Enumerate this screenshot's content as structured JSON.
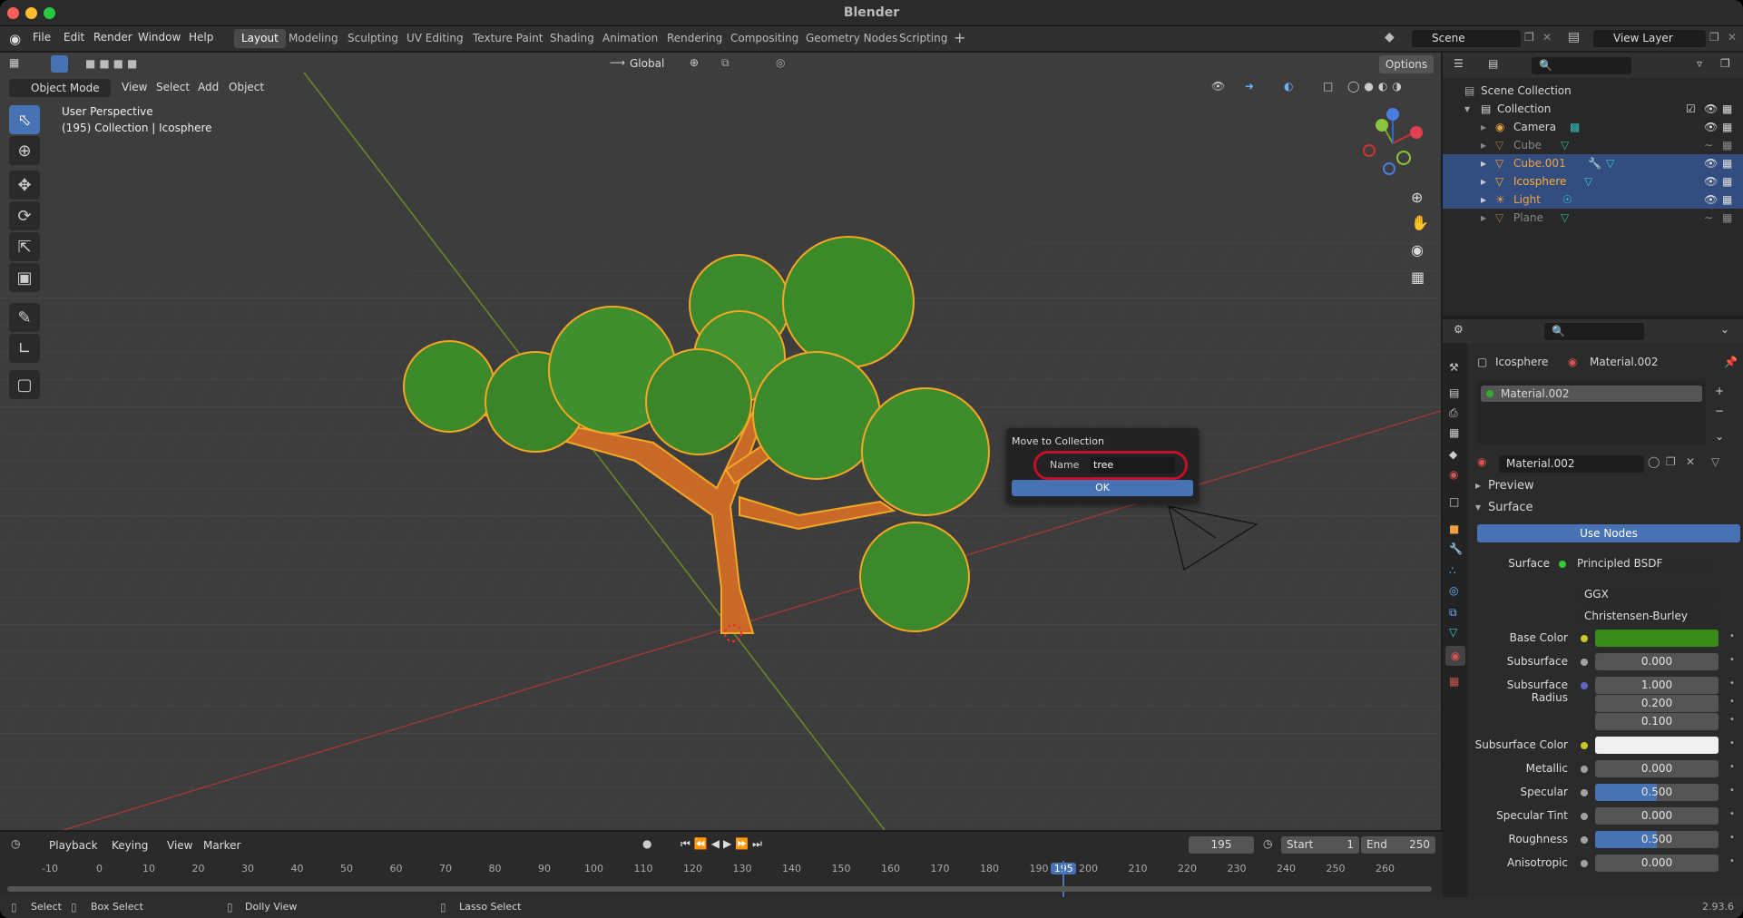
{
  "window": {
    "title": "Blender",
    "version": "2.93.6"
  },
  "menus": [
    "File",
    "Edit",
    "Render",
    "Window",
    "Help"
  ],
  "workspaces": [
    "Layout",
    "Modeling",
    "Sculpting",
    "UV Editing",
    "Texture Paint",
    "Shading",
    "Animation",
    "Rendering",
    "Compositing",
    "Geometry Nodes",
    "Scripting"
  ],
  "scene": {
    "name": "Scene",
    "view_layer": "View Layer"
  },
  "viewport": {
    "mode": "Object Mode",
    "menus": [
      "View",
      "Select",
      "Add",
      "Object"
    ],
    "orientation": "Global",
    "options": "Options",
    "info_line1": "User Perspective",
    "info_line2": "(195) Collection | Icosphere"
  },
  "popup": {
    "title": "Move to Collection",
    "name_label": "Name",
    "name_value": "tree",
    "ok": "OK"
  },
  "outliner": {
    "root": "Scene Collection",
    "collection": "Collection",
    "items": [
      {
        "name": "Camera",
        "selected": false,
        "dim": false
      },
      {
        "name": "Cube",
        "selected": false,
        "dim": true
      },
      {
        "name": "Cube.001",
        "selected": true,
        "dim": false
      },
      {
        "name": "Icosphere",
        "selected": true,
        "dim": false
      },
      {
        "name": "Light",
        "selected": true,
        "dim": false
      },
      {
        "name": "Plane",
        "selected": false,
        "dim": true
      }
    ]
  },
  "properties": {
    "object": "Icosphere",
    "material": "Material.002",
    "slot": "Material.002",
    "mat_field": "Material.002",
    "preview": "Preview",
    "surface_panel": "Surface",
    "use_nodes": "Use Nodes",
    "surface_label": "Surface",
    "surface_value": "Principled BSDF",
    "distribution": "GGX",
    "sss_method": "Christensen-Burley",
    "rows": [
      {
        "label": "Base Color",
        "value": "",
        "dot": "#c7c729",
        "type": "color",
        "color": "#3a8a1a"
      },
      {
        "label": "Subsurface",
        "value": "0.000",
        "dot": "#a1a1a1"
      },
      {
        "label": "Subsurface Radius",
        "value": "1.000",
        "dot": "#6363c7"
      },
      {
        "label": "",
        "value": "0.200",
        "dot": ""
      },
      {
        "label": "",
        "value": "0.100",
        "dot": ""
      },
      {
        "label": "Subsurface Color",
        "value": "",
        "dot": "#c7c729",
        "type": "color",
        "color": "#f0f0f0"
      },
      {
        "label": "Metallic",
        "value": "0.000",
        "dot": "#a1a1a1"
      },
      {
        "label": "Specular",
        "value": "0.500",
        "dot": "#a1a1a1",
        "fill": 0.5
      },
      {
        "label": "Specular Tint",
        "value": "0.000",
        "dot": "#a1a1a1"
      },
      {
        "label": "Roughness",
        "value": "0.500",
        "dot": "#a1a1a1",
        "fill": 0.5
      },
      {
        "label": "Anisotropic",
        "value": "0.000",
        "dot": "#a1a1a1"
      }
    ]
  },
  "timeline": {
    "menus": [
      "Playback",
      "Keying",
      "View",
      "Marker"
    ],
    "current_frame": "195",
    "start_label": "Start",
    "start": "1",
    "end_label": "End",
    "end": "250",
    "ticks": [
      "-10",
      "0",
      "10",
      "20",
      "30",
      "40",
      "50",
      "60",
      "70",
      "80",
      "90",
      "100",
      "110",
      "120",
      "130",
      "140",
      "150",
      "160",
      "170",
      "180",
      "190",
      "195",
      "200",
      "210",
      "220",
      "230",
      "240",
      "250",
      "260"
    ]
  },
  "status": {
    "select": "Select",
    "box_select": "Box Select",
    "dolly": "Dolly View",
    "lasso": "Lasso Select"
  },
  "colors": {
    "accent": "#4772b3",
    "selection": "#334d80",
    "highlight_ring": "#c0102a",
    "leaf": "#3f8f2e",
    "trunk": "#c86a28",
    "outline": "#f5a623"
  }
}
